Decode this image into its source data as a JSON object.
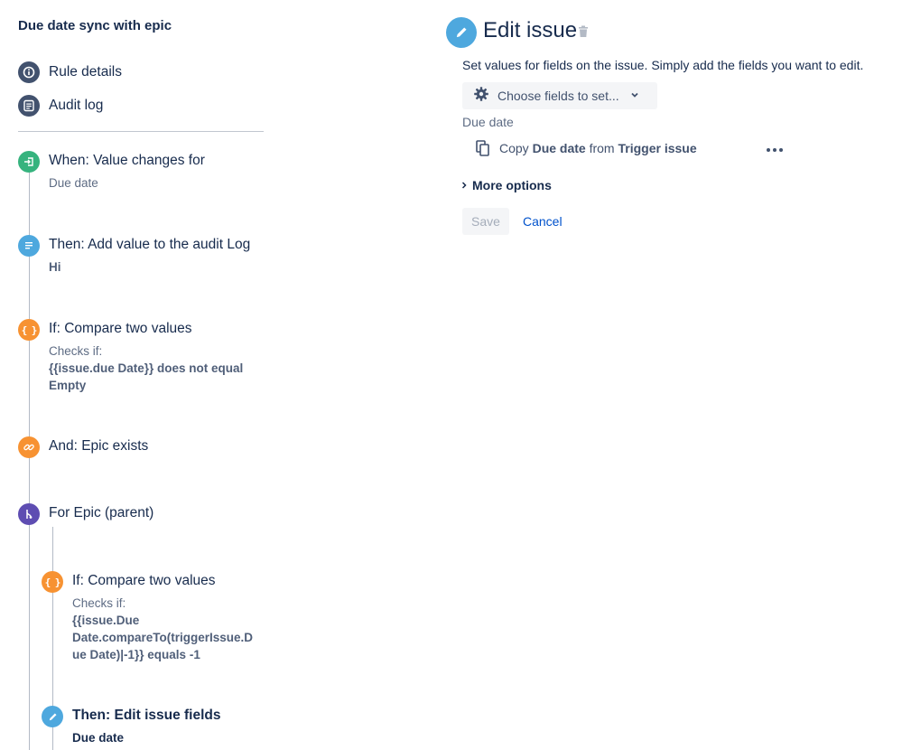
{
  "rule": {
    "title": "Due date sync with epic"
  },
  "nav": {
    "rule_details": "Rule details",
    "audit_log": "Audit log"
  },
  "steps": [
    {
      "title": "When: Value changes for",
      "line1": "Due date"
    },
    {
      "title": "Then: Add value to the audit Log",
      "line1": "Hi"
    },
    {
      "title": "If: Compare two values",
      "line1": "Checks if:",
      "line2": "{{issue.due Date}} does not equal",
      "line3": "Empty"
    },
    {
      "title": "And: Epic exists"
    },
    {
      "title": "For Epic (parent)"
    },
    {
      "title": "If: Compare two values",
      "line1": "Checks if:",
      "line2": "{{issue.Due",
      "line3": "Date.compareTo(triggerIssue.D",
      "line4": "ue Date)|-1}} equals -1"
    },
    {
      "title": "Then: Edit issue fields",
      "line1": "Due date"
    }
  ],
  "editor": {
    "title": "Edit issue",
    "description": "Set values for fields on the issue. Simply add the fields you want to edit.",
    "choose_fields": "Choose fields to set...",
    "field_label": "Due date",
    "copy_prefix": "Copy",
    "copy_field": "Due date",
    "copy_from": "from",
    "copy_source": "Trigger issue",
    "more_options": "More options",
    "save": "Save",
    "cancel": "Cancel"
  },
  "icons": {
    "rule_details": "info-icon",
    "audit_log": "list-icon",
    "trigger": "trigger-icon",
    "log_action": "log-icon",
    "condition": "braces-icon",
    "epic_exists": "link-icon",
    "branch": "branch-icon",
    "edit": "pencil-icon",
    "delete": "trash-icon",
    "settings": "gear-icon",
    "dropdown": "chevron-down-icon",
    "copy": "copy-icon",
    "more": "more-icon",
    "expand": "chevron-right-icon"
  },
  "colors": {
    "trigger": "#36b37e",
    "action": "#4ea8de",
    "condition": "#f79232",
    "branch": "#5e4db2",
    "nav_icon": "#42526e",
    "link": "#0052cc"
  }
}
